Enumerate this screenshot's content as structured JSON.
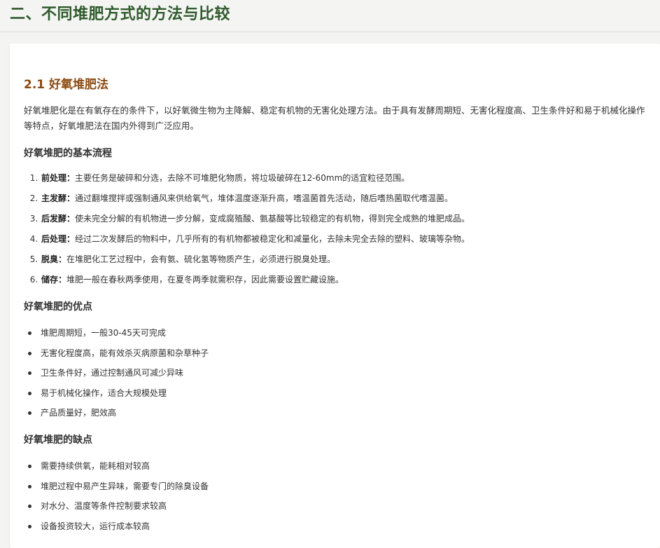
{
  "header": {
    "title": "二、不同堆肥方式的方法与比较"
  },
  "section": {
    "title": "2.1 好氧堆肥法",
    "intro": "好氧堆肥化是在有氧存在的条件下，以好氧微生物为主降解、稳定有机物的无害化处理方法。由于具有发酵周期短、无害化程度高、卫生条件好和易于机械化操作等特点，好氧堆肥法在国内外得到广泛应用。"
  },
  "process": {
    "title": "好氧堆肥的基本流程",
    "steps": [
      {
        "term": "前处理",
        "sep": "：",
        "text": "主要任务是破碎和分选，去除不可堆肥化物质，将垃圾破碎在12-60mm的适宜粒径范围。"
      },
      {
        "term": "主发酵",
        "sep": "：",
        "text": "通过翻堆搅拌或强制通风来供给氧气，堆体温度逐渐升高，嗜温菌首先活动，随后嗜热菌取代嗜温菌。"
      },
      {
        "term": "后发酵",
        "sep": "：",
        "text": "使未完全分解的有机物进一步分解，变成腐殖酸、氨基酸等比较稳定的有机物，得到完全成熟的堆肥成品。"
      },
      {
        "term": "后处理",
        "sep": "：",
        "text": "经过二次发酵后的物料中，几乎所有的有机物都被稳定化和减量化，去除未完全去除的塑料、玻璃等杂物。"
      },
      {
        "term": "脱臭",
        "sep": "：",
        "text": "在堆肥化工艺过程中，会有氨、硫化氢等物质产生，必须进行脱臭处理。"
      },
      {
        "term": "储存",
        "sep": "：",
        "text": "堆肥一般在春秋两季使用，在夏冬两季就需积存，因此需要设置贮藏设施。"
      }
    ]
  },
  "advantages": {
    "title": "好氧堆肥的优点",
    "items": [
      "堆肥周期短，一般30-45天可完成",
      "无害化程度高，能有效杀灭病原菌和杂草种子",
      "卫生条件好，通过控制通风可减少异味",
      "易于机械化操作，适合大规模处理",
      "产品质量好，肥效高"
    ]
  },
  "disadvantages": {
    "title": "好氧堆肥的缺点",
    "items": [
      "需要持续供氧，能耗相对较高",
      "堆肥过程中易产生异味，需要专门的除臭设备",
      "对水分、温度等条件控制要求较高",
      "设备投资较大，运行成本较高"
    ]
  },
  "colors": {
    "header_title": "#2f5a2c",
    "section_title": "#8a4a12",
    "text": "#333333",
    "background": "#f4f5f3"
  }
}
